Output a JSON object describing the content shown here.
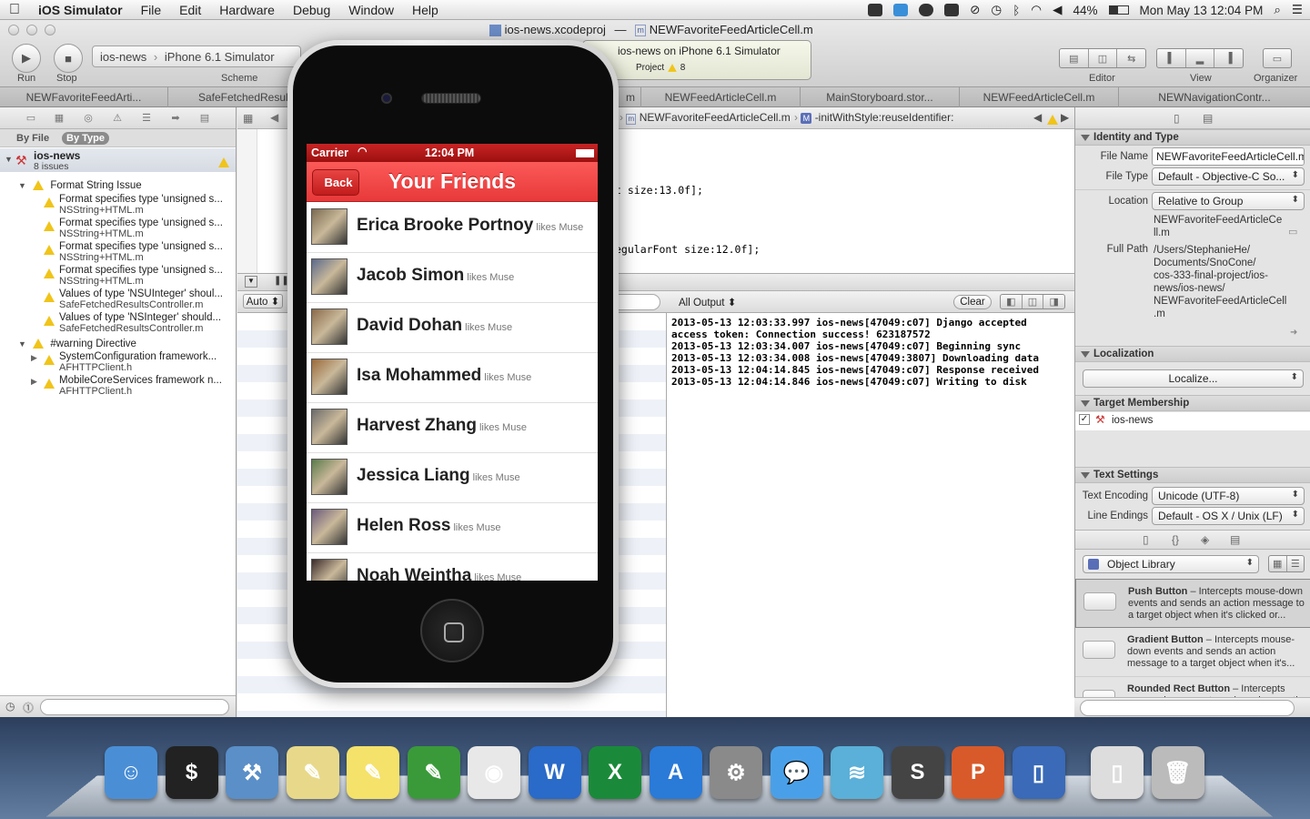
{
  "menubar": {
    "app_name": "iOS Simulator",
    "items": [
      "File",
      "Edit",
      "Hardware",
      "Debug",
      "Window",
      "Help"
    ],
    "battery": "44%",
    "clock": "Mon May 13  12:04 PM"
  },
  "window": {
    "title_project": "ios-news.xcodeproj",
    "title_sep": "—",
    "title_file": "NEWFavoriteFeedArticleCell.m"
  },
  "toolbar": {
    "run_label": "Run",
    "stop_label": "Stop",
    "scheme_project": "ios-news",
    "scheme_sep": "›",
    "scheme_target": "iPhone 6.1 Simulator",
    "scheme_label": "Scheme",
    "activity_text": "ios-news on iPhone 6.1 Simulator",
    "activity_project": "Project",
    "activity_count": "8",
    "editor_label": "Editor",
    "view_label": "View",
    "organizer_label": "Organizer"
  },
  "tabs": [
    "NEWFavoriteFeedArti...",
    "SafeFetchedResults",
    "m",
    "NEWFeedArticleCell.m",
    "MainStoryboard.stor...",
    "NEWFeedArticleCell.m",
    "NEWNavigationContr..."
  ],
  "navigator": {
    "filter_by_file": "By File",
    "filter_by_type": "By Type",
    "project_name": "ios-news",
    "project_issues": "8 issues",
    "group1": "Format String Issue",
    "issues": [
      {
        "title": "Format specifies type 'unsigned s...",
        "file": "NSString+HTML.m"
      },
      {
        "title": "Format specifies type 'unsigned s...",
        "file": "NSString+HTML.m"
      },
      {
        "title": "Format specifies type 'unsigned s...",
        "file": "NSString+HTML.m"
      },
      {
        "title": "Format specifies type 'unsigned s...",
        "file": "NSString+HTML.m"
      },
      {
        "title": "Values of type 'NSUInteger' shoul...",
        "file": "SafeFetchedResultsController.m"
      },
      {
        "title": "Values of type 'NSInteger' should...",
        "file": "SafeFetchedResultsController.m"
      }
    ],
    "group2": "#warning Directive",
    "directives": [
      {
        "title": "SystemConfiguration framework...",
        "file": "AFHTTPClient.h"
      },
      {
        "title": "MobileCoreServices framework n...",
        "file": "AFHTTPClient.h"
      }
    ]
  },
  "editor": {
    "jump_file": "NEWFavoriteFeedArticleCell.m",
    "jump_sep": "›",
    "jump_method_badge": "M",
    "jump_method": "-initWithStyle:reuseIdentifier:",
    "code_line1": "t size:13.0f];",
    "code_line2": "egularFont size:12.0f];",
    "vars_scope": "Auto ⬍",
    "output_select": "All Output ⬍",
    "clear_label": "Clear",
    "console_lines": [
      "2013-05-13 12:03:33.997 ios-news[47049:c07] Django accepted",
      "access token: Connection success! 623187572",
      "2013-05-13 12:03:34.007 ios-news[47049:c07] Beginning sync",
      "2013-05-13 12:03:34.008 ios-news[47049:3807] Downloading data",
      "2013-05-13 12:04:14.845 ios-news[47049:c07] Response received",
      "2013-05-13 12:04:14.846 ios-news[47049:c07] Writing to disk"
    ]
  },
  "utilities": {
    "identity_header": "Identity and Type",
    "file_name_label": "File Name",
    "file_name_value": "NEWFavoriteFeedArticleCell.m",
    "file_type_label": "File Type",
    "file_type_value": "Default - Objective-C So...",
    "location_label": "Location",
    "location_value": "Relative to Group",
    "location_path_1": "NEWFavoriteFeedArticleCe",
    "location_path_2": "ll.m",
    "full_path_label": "Full Path",
    "full_path_lines": [
      "/Users/StephanieHe/",
      "Documents/SnoCone/",
      "cos-333-final-project/ios-",
      "news/ios-news/",
      "NEWFavoriteFeedArticleCell",
      ".m"
    ],
    "localization_header": "Localization",
    "localize_button": "Localize...",
    "target_header": "Target Membership",
    "target_name": "ios-news",
    "text_settings_header": "Text Settings",
    "text_encoding_label": "Text Encoding",
    "text_encoding_value": "Unicode (UTF-8)",
    "line_endings_label": "Line Endings",
    "line_endings_value": "Default - OS X / Unix (LF)",
    "library_select": "Object Library",
    "library_items": [
      {
        "name": "Push Button",
        "desc": " – Intercepts mouse-down events and sends an action message to a target object when it's clicked or..."
      },
      {
        "name": "Gradient Button",
        "desc": " – Intercepts mouse-down events and sends an action message to a target object when it's..."
      },
      {
        "name": "Rounded Rect Button",
        "desc": " – Intercepts mouse-down events and sends an action message to a target object..."
      }
    ]
  },
  "simulator": {
    "carrier": "Carrier",
    "time": "12:04 PM",
    "back_label": "Back",
    "title": "Your Friends",
    "friends": [
      {
        "name": "Erica Brooke Portnoy",
        "likes": "likes Muse"
      },
      {
        "name": "Jacob Simon",
        "likes": "likes Muse"
      },
      {
        "name": "David Dohan",
        "likes": "likes Muse"
      },
      {
        "name": "Isa Mohammed",
        "likes": "likes Muse"
      },
      {
        "name": "Harvest Zhang",
        "likes": "likes Muse"
      },
      {
        "name": "Jessica Liang",
        "likes": "likes Muse"
      },
      {
        "name": "Helen Ross",
        "likes": "likes Muse"
      },
      {
        "name": "Noah Weintha",
        "likes": "likes Muse"
      }
    ]
  },
  "colors": {
    "nav_red": "#f04646",
    "warning_yellow": "#f0c419",
    "dock_blue": "#3d5577"
  },
  "dock_icons": [
    "finder-icon",
    "terminal-icon",
    "xcode-icon",
    "textedit-icon",
    "stickies-icon",
    "evernote-icon",
    "chrome-icon",
    "word-icon",
    "excel-icon",
    "app-store-icon",
    "system-preferences-icon",
    "messages-icon",
    "dash-icon",
    "sublime-text-icon",
    "powerpoint-icon",
    "ios-simulator-icon",
    "documents-stack-icon",
    "trash-icon"
  ]
}
